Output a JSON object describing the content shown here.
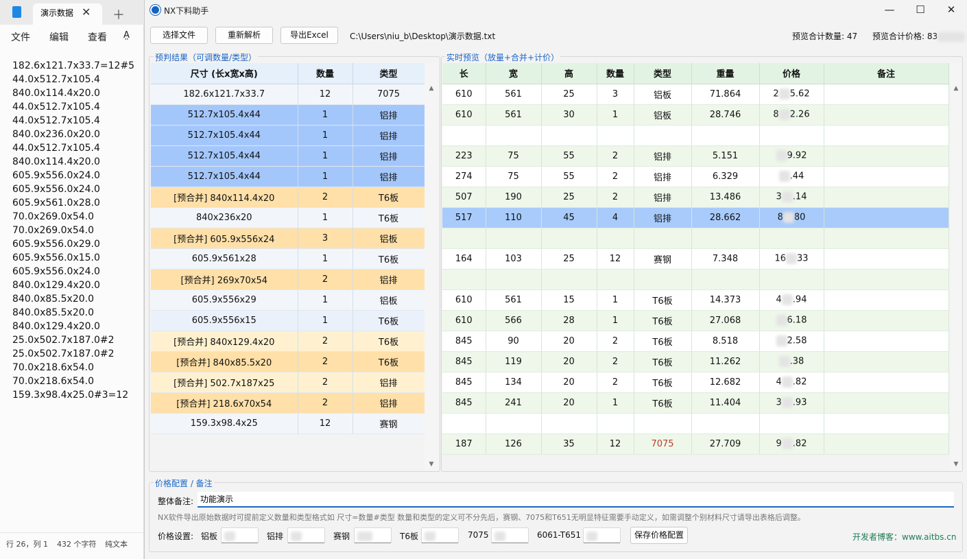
{
  "notepad": {
    "tab_title": "演示数据",
    "close_glyph": "✕",
    "new_tab_glyph": "＋",
    "menu": [
      "文件",
      "编辑",
      "查看"
    ],
    "lines": [
      "182.6x121.7x33.7=12#5",
      "44.0x512.7x105.4",
      "840.0x114.4x20.0",
      "44.0x512.7x105.4",
      "44.0x512.7x105.4",
      "840.0x236.0x20.0",
      "44.0x512.7x105.4",
      "840.0x114.4x20.0",
      "605.9x556.0x24.0",
      "605.9x556.0x24.0",
      "605.9x561.0x28.0",
      "70.0x269.0x54.0",
      "70.0x269.0x54.0",
      "605.9x556.0x29.0",
      "605.9x556.0x15.0",
      "605.9x556.0x24.0",
      "840.0x129.4x20.0",
      "840.0x85.5x20.0",
      "840.0x85.5x20.0",
      "840.0x129.4x20.0",
      "25.0x502.7x187.0#2",
      "25.0x502.7x187.0#2",
      "70.0x218.6x54.0",
      "70.0x218.6x54.0",
      "159.3x98.4x25.0#3=12"
    ],
    "status": {
      "position": "行 26，列 1",
      "chars": "432 个字符",
      "format": "纯文本"
    }
  },
  "window": {
    "title": "NX下料助手",
    "controls": {
      "minimize": "—",
      "maximize": "☐",
      "close": "✕"
    }
  },
  "toolbar": {
    "select_file": "选择文件",
    "reparse": "重新解析",
    "export_excel": "导出Excel",
    "path": "C:\\Users\\niu_b\\Desktop\\演示数据.txt",
    "preview_count_label": "预览合计数量:",
    "preview_count": "47",
    "preview_price_label": "预览合计价格:",
    "preview_price_visible": "83"
  },
  "prejudge": {
    "title": "预判结果（可调数量/类型）",
    "headers": [
      "尺寸 (长x宽x高)",
      "数量",
      "类型"
    ],
    "rows": [
      {
        "size": "182.6x121.7x33.7",
        "qty": "12",
        "type": "7075",
        "style": "normal"
      },
      {
        "size": "512.7x105.4x44",
        "qty": "1",
        "type": "铝排",
        "style": "selected"
      },
      {
        "size": "512.7x105.4x44",
        "qty": "1",
        "type": "铝排",
        "style": "selected"
      },
      {
        "size": "512.7x105.4x44",
        "qty": "1",
        "type": "铝排",
        "style": "selected"
      },
      {
        "size": "512.7x105.4x44",
        "qty": "1",
        "type": "铝排",
        "style": "selected"
      },
      {
        "size": "[预合并] 840x114.4x20",
        "qty": "2",
        "type": "T6板",
        "style": "merged"
      },
      {
        "size": "840x236x20",
        "qty": "1",
        "type": "T6板",
        "style": "normal"
      },
      {
        "size": "[预合并] 605.9x556x24",
        "qty": "3",
        "type": "铝板",
        "style": "merged"
      },
      {
        "size": "605.9x561x28",
        "qty": "1",
        "type": "T6板",
        "style": "normal"
      },
      {
        "size": "[预合并] 269x70x54",
        "qty": "2",
        "type": "铝排",
        "style": "merged"
      },
      {
        "size": "605.9x556x29",
        "qty": "1",
        "type": "铝板",
        "style": "normal"
      },
      {
        "size": "605.9x556x15",
        "qty": "1",
        "type": "T6板",
        "style": "normal2"
      },
      {
        "size": "[预合并] 840x129.4x20",
        "qty": "2",
        "type": "T6板",
        "style": "merged2"
      },
      {
        "size": "[预合并] 840x85.5x20",
        "qty": "2",
        "type": "T6板",
        "style": "merged"
      },
      {
        "size": "[预合并] 502.7x187x25",
        "qty": "2",
        "type": "铝排",
        "style": "merged2"
      },
      {
        "size": "[预合并] 218.6x70x54",
        "qty": "2",
        "type": "铝排",
        "style": "merged"
      },
      {
        "size": "159.3x98.4x25",
        "qty": "12",
        "type": "赛钢",
        "style": "normal"
      }
    ]
  },
  "preview": {
    "title": "实时预览（放量+合并+计价）",
    "headers": [
      "长",
      "宽",
      "高",
      "数量",
      "类型",
      "重量",
      "价格",
      "备注"
    ],
    "rows": [
      {
        "l": "610",
        "w": "561",
        "h": "25",
        "qty": "3",
        "type": "铝板",
        "weight": "71.864",
        "price_head": "2",
        "price_tail": "5.62",
        "note": "",
        "style": "white"
      },
      {
        "l": "610",
        "w": "561",
        "h": "30",
        "qty": "1",
        "type": "铝板",
        "weight": "28.746",
        "price_head": "8",
        "price_tail": "2.26",
        "note": "",
        "style": "green"
      },
      {
        "l": "",
        "w": "",
        "h": "",
        "qty": "",
        "type": "",
        "weight": "",
        "price_head": "",
        "price_tail": "",
        "note": "",
        "style": "white"
      },
      {
        "l": "223",
        "w": "75",
        "h": "55",
        "qty": "2",
        "type": "铝排",
        "weight": "5.151",
        "price_head": "",
        "price_tail": "9.92",
        "note": "",
        "style": "green"
      },
      {
        "l": "274",
        "w": "75",
        "h": "55",
        "qty": "2",
        "type": "铝排",
        "weight": "6.329",
        "price_head": "",
        "price_tail": ".44",
        "note": "",
        "style": "white"
      },
      {
        "l": "507",
        "w": "190",
        "h": "25",
        "qty": "2",
        "type": "铝排",
        "weight": "13.486",
        "price_head": "3",
        "price_tail": ".14",
        "note": "",
        "style": "green"
      },
      {
        "l": "517",
        "w": "110",
        "h": "45",
        "qty": "4",
        "type": "铝排",
        "weight": "28.662",
        "price_head": "8",
        "price_tail": "80",
        "note": "",
        "style": "selected"
      },
      {
        "l": "",
        "w": "",
        "h": "",
        "qty": "",
        "type": "",
        "weight": "",
        "price_head": "",
        "price_tail": "",
        "note": "",
        "style": "green"
      },
      {
        "l": "164",
        "w": "103",
        "h": "25",
        "qty": "12",
        "type": "赛钢",
        "weight": "7.348",
        "price_head": "16",
        "price_tail": "33",
        "note": "",
        "style": "white"
      },
      {
        "l": "",
        "w": "",
        "h": "",
        "qty": "",
        "type": "",
        "weight": "",
        "price_head": "",
        "price_tail": "",
        "note": "",
        "style": "green"
      },
      {
        "l": "610",
        "w": "561",
        "h": "15",
        "qty": "1",
        "type": "T6板",
        "weight": "14.373",
        "price_head": "4",
        "price_tail": ".94",
        "note": "",
        "style": "white"
      },
      {
        "l": "610",
        "w": "566",
        "h": "28",
        "qty": "1",
        "type": "T6板",
        "weight": "27.068",
        "price_head": "",
        "price_tail": "6.18",
        "note": "",
        "style": "green"
      },
      {
        "l": "845",
        "w": "90",
        "h": "20",
        "qty": "2",
        "type": "T6板",
        "weight": "8.518",
        "price_head": "",
        "price_tail": "2.58",
        "note": "",
        "style": "white"
      },
      {
        "l": "845",
        "w": "119",
        "h": "20",
        "qty": "2",
        "type": "T6板",
        "weight": "11.262",
        "price_head": "",
        "price_tail": ".38",
        "note": "",
        "style": "green"
      },
      {
        "l": "845",
        "w": "134",
        "h": "20",
        "qty": "2",
        "type": "T6板",
        "weight": "12.682",
        "price_head": "4",
        "price_tail": ".82",
        "note": "",
        "style": "white"
      },
      {
        "l": "845",
        "w": "241",
        "h": "20",
        "qty": "1",
        "type": "T6板",
        "weight": "11.404",
        "price_head": "3",
        "price_tail": ".93",
        "note": "",
        "style": "green"
      },
      {
        "l": "",
        "w": "",
        "h": "",
        "qty": "",
        "type": "",
        "weight": "",
        "price_head": "",
        "price_tail": "",
        "note": "",
        "style": "white"
      },
      {
        "l": "187",
        "w": "126",
        "h": "35",
        "qty": "12",
        "type": "7075",
        "weight": "27.709",
        "price_head": "9",
        "price_tail": ".82",
        "note": "",
        "style": "green",
        "type_color": "#c0392b"
      }
    ]
  },
  "config": {
    "title": "价格配置 / 备注",
    "note_label": "整体备注:",
    "note_value": "功能演示",
    "hint": "NX软件导出原始数据时可提前定义数量和类型格式如  尺寸=数量#类型  数量和类型的定义可不分先后，赛钢、7075和T651无明显特征需要手动定义，如需调整个别材料尺寸请导出表格后调整。",
    "price_label": "价格设置:",
    "materials": [
      "铝板",
      "铝排",
      "赛钢",
      "T6板",
      "7075",
      "6061-T651"
    ],
    "save": "保存价格配置",
    "developer": "开发者博客：www.aitbs.cn"
  },
  "colors": {
    "accent": "#1a66c8",
    "selected": "#a4c7fb",
    "merged": "#ffe0a8",
    "merged_light": "#fff1cf",
    "row_light": "#f2f6fb",
    "row_light2": "#eaf1fb",
    "preview_green": "#eef7ea",
    "preview_selected": "#a8cbfb",
    "developer": "#1e7c55"
  }
}
